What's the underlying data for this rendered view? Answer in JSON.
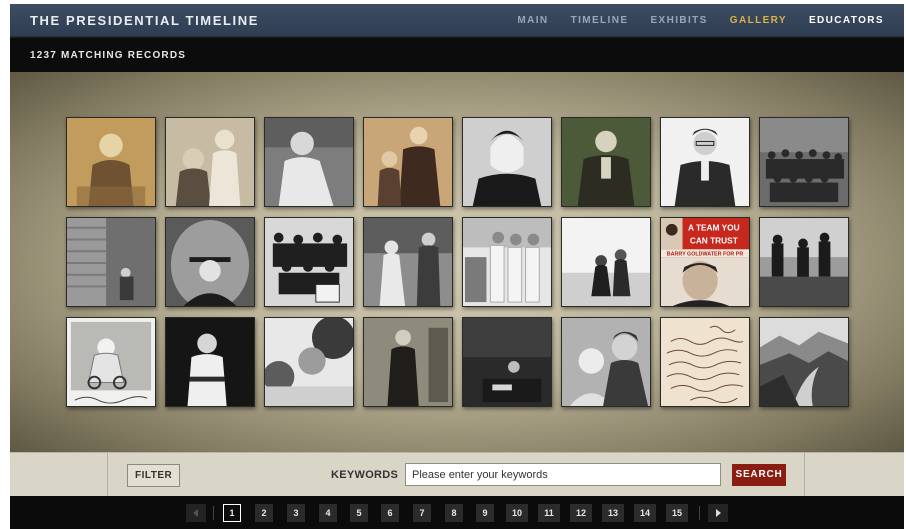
{
  "site": {
    "title": "THE PRESIDENTIAL TIMELINE"
  },
  "nav": {
    "items": [
      {
        "label": "MAIN"
      },
      {
        "label": "TIMELINE"
      },
      {
        "label": "EXHIBITS"
      },
      {
        "label": "GALLERY"
      },
      {
        "label": "EDUCATORS"
      }
    ],
    "active": "GALLERY"
  },
  "records": {
    "label": "1237 MATCHING RECORDS"
  },
  "gallery": {
    "thumbnails": [
      {
        "subject": "toddler seated, sepia portrait"
      },
      {
        "subject": "two children with adult, sepia"
      },
      {
        "subject": "infant portrait"
      },
      {
        "subject": "woman standing with boy"
      },
      {
        "subject": "young boy portrait"
      },
      {
        "subject": "young man in suit, green tint"
      },
      {
        "subject": "young man with glasses"
      },
      {
        "subject": "group photo outdoors"
      },
      {
        "subject": "house porch with figure"
      },
      {
        "subject": "graduate in cap, oval frame"
      },
      {
        "subject": "group of men standing"
      },
      {
        "subject": "couple in garden"
      },
      {
        "subject": "group of women"
      },
      {
        "subject": "couple seated outdoors"
      },
      {
        "subject": "campaign poster",
        "text_top": "A TEAM YOU",
        "text_mid": "CAN TRUST",
        "text_band": "BARRY GOLDWATER FOR PR"
      },
      {
        "subject": "soldiers in field"
      },
      {
        "subject": "baby in stroller, captioned photo"
      },
      {
        "subject": "toddler standing"
      },
      {
        "subject": "garden scene"
      },
      {
        "subject": "man in uniform"
      },
      {
        "subject": "man at desk"
      },
      {
        "subject": "mother with baby"
      },
      {
        "subject": "handwritten letter"
      },
      {
        "subject": "mountain valley landscape"
      }
    ]
  },
  "filterbar": {
    "filter_label": "FILTER",
    "keywords_label": "KEYWORDS",
    "search_placeholder": "Please enter your keywords",
    "search_label": "SEARCH"
  },
  "pagination": {
    "pages": [
      "1",
      "2",
      "3",
      "4",
      "5",
      "6",
      "7",
      "8",
      "9",
      "10",
      "11",
      "12",
      "13",
      "14",
      "15"
    ],
    "current": "1"
  },
  "colors": {
    "nav_bg": "#34435a",
    "accent_gold": "#d9b24a",
    "search_red": "#8a1d12",
    "gallery_bg": "#b9b196"
  }
}
